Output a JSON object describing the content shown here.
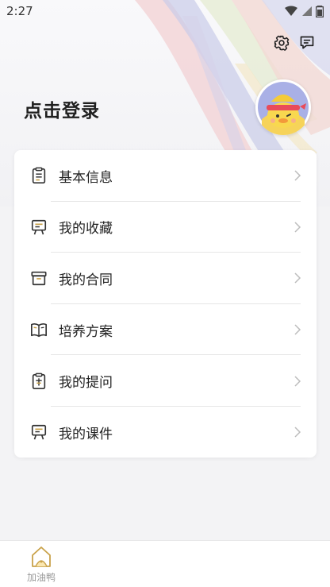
{
  "status_bar": {
    "time": "2:27"
  },
  "header": {
    "login_text": "点击登录"
  },
  "menu": [
    {
      "label": "基本信息",
      "icon": "clipboard-list-icon"
    },
    {
      "label": "我的收藏",
      "icon": "easel-icon"
    },
    {
      "label": "我的合同",
      "icon": "box-icon"
    },
    {
      "label": "培养方案",
      "icon": "book-icon"
    },
    {
      "label": "我的提问",
      "icon": "clipboard-question-icon"
    },
    {
      "label": "我的课件",
      "icon": "easel-icon"
    }
  ],
  "tab_bar": {
    "home_label": "加油鸭"
  },
  "colors": {
    "accent_gold": "#c9a24a",
    "icon_dark": "#333333",
    "chevron": "#bdbdbd"
  }
}
